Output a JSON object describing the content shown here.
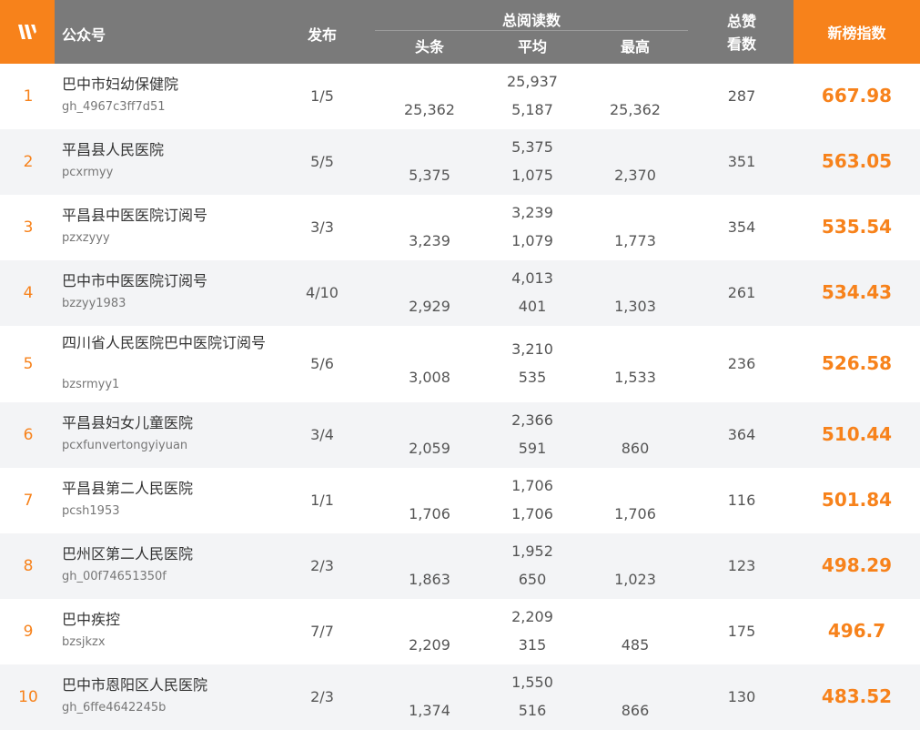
{
  "header": {
    "account": "公众号",
    "publish": "发布",
    "total_reads": "总阅读数",
    "headline": "头条",
    "average": "平均",
    "max": "最高",
    "likes_line1": "总赞",
    "likes_line2": "看数",
    "index": "新榜指数"
  },
  "colors": {
    "accent": "#f7821b",
    "header_bg": "#7a7a7a",
    "alt_row": "#f3f4f6"
  },
  "rows": [
    {
      "rank": "1",
      "name": "巴中市妇幼保健院",
      "id": "gh_4967c3ff7d51",
      "publish": "1/5",
      "total": "25,937",
      "headline": "25,362",
      "average": "5,187",
      "max": "25,362",
      "likes": "287",
      "index": "667.98"
    },
    {
      "rank": "2",
      "name": "平昌县人民医院",
      "id": "pcxrmyy",
      "publish": "5/5",
      "total": "5,375",
      "headline": "5,375",
      "average": "1,075",
      "max": "2,370",
      "likes": "351",
      "index": "563.05"
    },
    {
      "rank": "3",
      "name": "平昌县中医医院订阅号",
      "id": "pzxzyyy",
      "publish": "3/3",
      "total": "3,239",
      "headline": "3,239",
      "average": "1,079",
      "max": "1,773",
      "likes": "354",
      "index": "535.54"
    },
    {
      "rank": "4",
      "name": "巴中市中医医院订阅号",
      "id": "bzzyy1983",
      "publish": "4/10",
      "total": "4,013",
      "headline": "2,929",
      "average": "401",
      "max": "1,303",
      "likes": "261",
      "index": "534.43"
    },
    {
      "rank": "5",
      "name": "四川省人民医院巴中医院订阅号",
      "id": "bzsrmyy1",
      "publish": "5/6",
      "total": "3,210",
      "headline": "3,008",
      "average": "535",
      "max": "1,533",
      "likes": "236",
      "index": "526.58"
    },
    {
      "rank": "6",
      "name": "平昌县妇女儿童医院",
      "id": "pcxfunvertongyiyuan",
      "publish": "3/4",
      "total": "2,366",
      "headline": "2,059",
      "average": "591",
      "max": "860",
      "likes": "364",
      "index": "510.44"
    },
    {
      "rank": "7",
      "name": "平昌县第二人民医院",
      "id": "pcsh1953",
      "publish": "1/1",
      "total": "1,706",
      "headline": "1,706",
      "average": "1,706",
      "max": "1,706",
      "likes": "116",
      "index": "501.84"
    },
    {
      "rank": "8",
      "name": "巴州区第二人民医院",
      "id": "gh_00f74651350f",
      "publish": "2/3",
      "total": "1,952",
      "headline": "1,863",
      "average": "650",
      "max": "1,023",
      "likes": "123",
      "index": "498.29"
    },
    {
      "rank": "9",
      "name": "巴中疾控",
      "id": "bzsjkzx",
      "publish": "7/7",
      "total": "2,209",
      "headline": "2,209",
      "average": "315",
      "max": "485",
      "likes": "175",
      "index": "496.7"
    },
    {
      "rank": "10",
      "name": "巴中市恩阳区人民医院",
      "id": "gh_6ffe4642245b",
      "publish": "2/3",
      "total": "1,550",
      "headline": "1,374",
      "average": "516",
      "max": "866",
      "likes": "130",
      "index": "483.52"
    }
  ]
}
